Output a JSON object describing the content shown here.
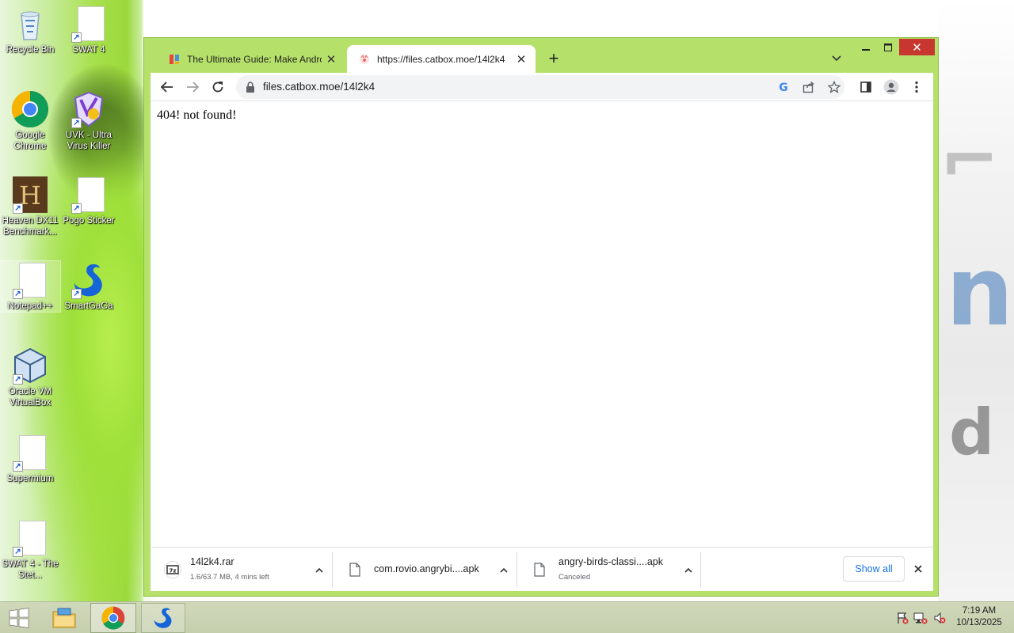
{
  "desktop": {
    "icons": [
      {
        "label": "Recycle Bin"
      },
      {
        "label": "SWAT 4"
      },
      {
        "label": "Google Chrome"
      },
      {
        "label": "UVK - Ultra Virus Killer"
      },
      {
        "label": "Heaven DX11 Benchmark..."
      },
      {
        "label": "Pogo Sticker"
      },
      {
        "label": "Notepad++"
      },
      {
        "label": "SmartGaGa"
      },
      {
        "label": "Oracle VM VirtualBox"
      },
      {
        "label": "Supermium"
      },
      {
        "label": "SWAT 4 - The Stet..."
      }
    ]
  },
  "browser": {
    "tabs": [
      {
        "title": "The Ultimate Guide: Make Andro",
        "active": false
      },
      {
        "title": "https://files.catbox.moe/14l2k4",
        "active": true
      }
    ],
    "address": "files.catbox.moe/14l2k4",
    "page_text": "404! not found!",
    "downloads": [
      {
        "name": "14l2k4.rar",
        "status": "1.6/63.7 MB, 4 mins left"
      },
      {
        "name": "com.rovio.angrybi....apk",
        "status": ""
      },
      {
        "name": "angry-birds-classi....apk",
        "status": "Canceled"
      }
    ],
    "show_all_label": "Show all",
    "frame_color": "#b5e06a",
    "accent_color": "#1a73e8"
  },
  "taskbar": {
    "time": "7:19 AM",
    "date": "10/13/2025"
  }
}
